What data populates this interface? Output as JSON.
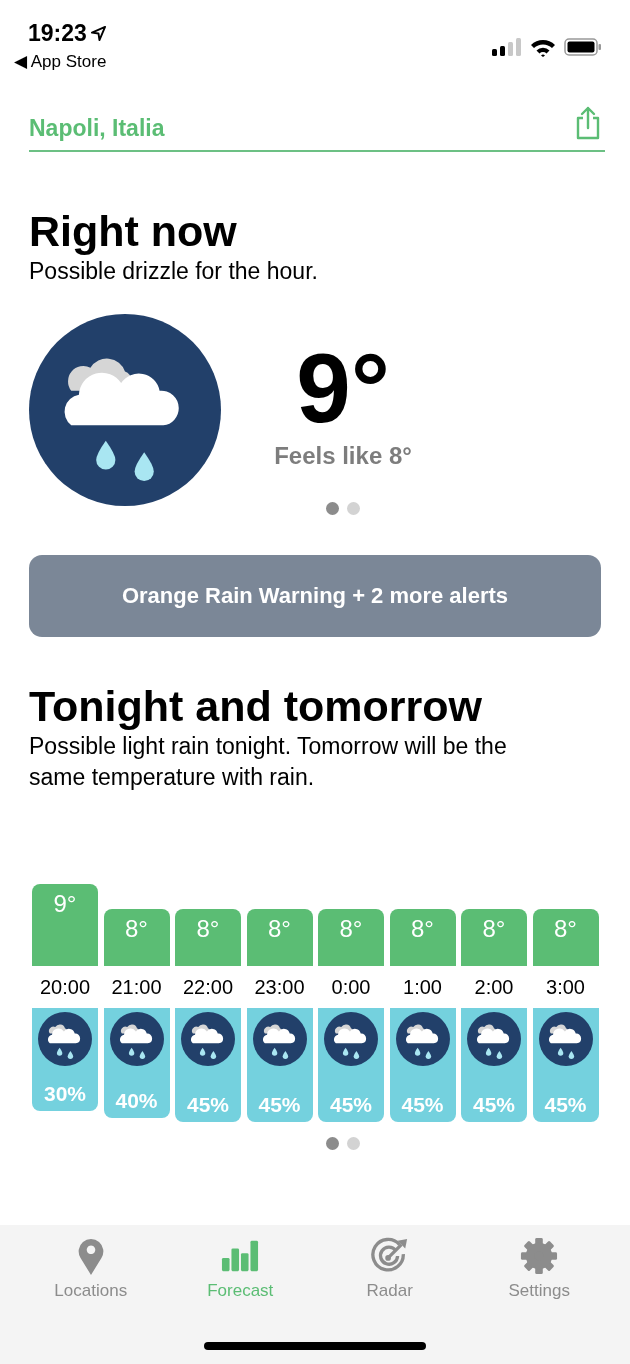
{
  "status_bar": {
    "time": "19:23",
    "back_link": "◀ App Store"
  },
  "location": {
    "name": "Napoli, Italia"
  },
  "right_now": {
    "title": "Right now",
    "summary": "Possible drizzle for the hour.",
    "temperature": "9°",
    "feels_like": "Feels like 8°",
    "pages": [
      {
        "selected": true
      },
      {
        "selected": false
      }
    ]
  },
  "alert": {
    "label": "Orange Rain Warning + 2 more alerts"
  },
  "tonight": {
    "title": "Tonight and tomorrow",
    "summary": "Possible light rain tonight. Tomorrow will be the same temperature with rain.",
    "hours": [
      {
        "temp": "9°",
        "time": "20:00",
        "precip": "30%"
      },
      {
        "temp": "8°",
        "time": "21:00",
        "precip": "40%"
      },
      {
        "temp": "8°",
        "time": "22:00",
        "precip": "45%"
      },
      {
        "temp": "8°",
        "time": "23:00",
        "precip": "45%"
      },
      {
        "temp": "8°",
        "time": "0:00",
        "precip": "45%"
      },
      {
        "temp": "8°",
        "time": "1:00",
        "precip": "45%"
      },
      {
        "temp": "8°",
        "time": "2:00",
        "precip": "45%"
      },
      {
        "temp": "8°",
        "time": "3:00",
        "precip": "45%"
      }
    ],
    "pages": [
      {
        "selected": true
      },
      {
        "selected": false
      }
    ]
  },
  "tab_bar": [
    {
      "label": "Locations",
      "kind": "pin",
      "selected": false
    },
    {
      "label": "Forecast",
      "kind": "chart",
      "selected": true
    },
    {
      "label": "Radar",
      "kind": "radar",
      "selected": false
    },
    {
      "label": "Settings",
      "kind": "gear",
      "selected": false
    }
  ]
}
